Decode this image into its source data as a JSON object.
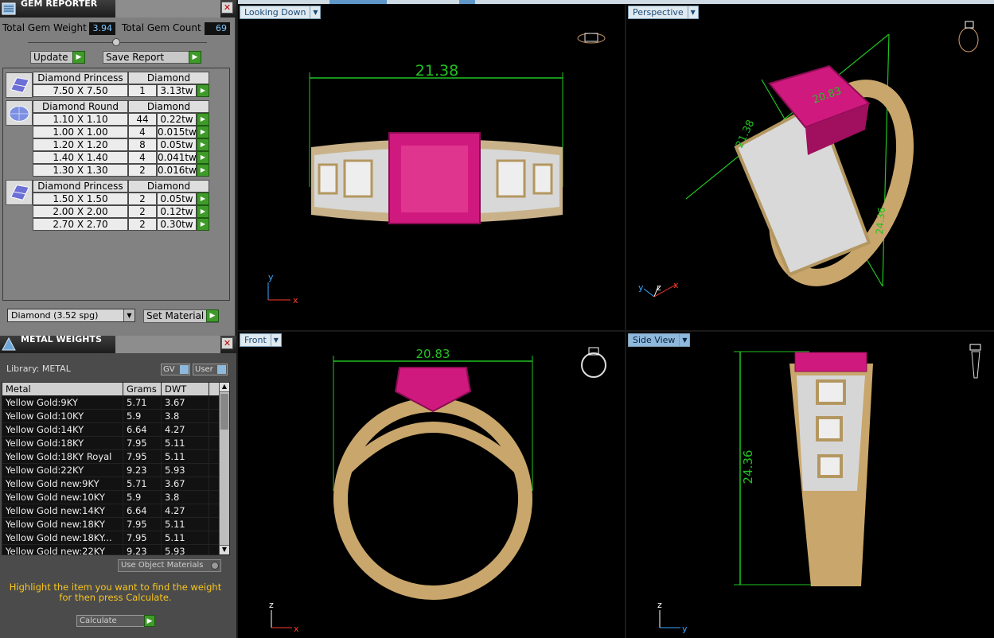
{
  "gem_reporter": {
    "title": "GEM REPORTER",
    "total_weight_label": "Total Gem Weight",
    "total_weight": "3.94",
    "total_count_label": "Total Gem Count",
    "total_count": "69",
    "update_label": "Update",
    "save_report_label": "Save Report",
    "groups": [
      {
        "name": "Diamond Princess",
        "material": "Diamond",
        "rows": [
          {
            "size": "7.50 X 7.50",
            "count": "1",
            "weight": "3.13tw"
          }
        ]
      },
      {
        "name": "Diamond Round",
        "material": "Diamond",
        "rows": [
          {
            "size": "1.10 X 1.10",
            "count": "44",
            "weight": "0.22tw"
          },
          {
            "size": "1.00 X 1.00",
            "count": "4",
            "weight": "0.015tw"
          },
          {
            "size": "1.20 X 1.20",
            "count": "8",
            "weight": "0.05tw"
          },
          {
            "size": "1.40 X 1.40",
            "count": "4",
            "weight": "0.041tw"
          },
          {
            "size": "1.30 X 1.30",
            "count": "2",
            "weight": "0.016tw"
          }
        ]
      },
      {
        "name": "Diamond Princess",
        "material": "Diamond",
        "rows": [
          {
            "size": "1.50 X 1.50",
            "count": "2",
            "weight": "0.05tw"
          },
          {
            "size": "2.00 X 2.00",
            "count": "2",
            "weight": "0.12tw"
          },
          {
            "size": "2.70 X 2.70",
            "count": "2",
            "weight": "0.30tw"
          }
        ]
      }
    ],
    "material_select": "Diamond     (3.52 spg)",
    "set_material_label": "Set Material"
  },
  "metal_weights": {
    "title": "METAL WEIGHTS",
    "library_label": "Library: METAL",
    "gv_label": "GV",
    "user_label": "User",
    "columns": [
      "Metal",
      "Grams",
      "DWT"
    ],
    "rows": [
      [
        "Yellow Gold:9KY",
        "5.71",
        "3.67"
      ],
      [
        "Yellow Gold:10KY",
        "5.9",
        "3.8"
      ],
      [
        "Yellow Gold:14KY",
        "6.64",
        "4.27"
      ],
      [
        "Yellow Gold:18KY",
        "7.95",
        "5.11"
      ],
      [
        "Yellow Gold:18KY Royal",
        "7.95",
        "5.11"
      ],
      [
        "Yellow Gold:22KY",
        "9.23",
        "5.93"
      ],
      [
        "Yellow Gold new:9KY",
        "5.71",
        "3.67"
      ],
      [
        "Yellow Gold new:10KY",
        "5.9",
        "3.8"
      ],
      [
        "Yellow Gold new:14KY",
        "6.64",
        "4.27"
      ],
      [
        "Yellow Gold new:18KY",
        "7.95",
        "5.11"
      ],
      [
        "Yellow Gold new:18KY...",
        "7.95",
        "5.11"
      ],
      [
        "Yellow Gold new:22KY",
        "9.23",
        "5.93"
      ]
    ],
    "use_object_materials_label": "Use Object Materials",
    "hint": "Highlight the item you want to find the weight for then press Calculate.",
    "calculate_label": "Calculate"
  },
  "viewports": [
    {
      "label": "Looking Down",
      "dimension": "21.38",
      "axes": [
        "y",
        "x"
      ]
    },
    {
      "label": "Perspective",
      "dimension": "20.83",
      "dimension2": "21.38",
      "dimension3": "24.36",
      "axes": [
        "y",
        "z",
        "x"
      ]
    },
    {
      "label": "Front",
      "dimension": "20.83",
      "axes": [
        "z",
        "x"
      ]
    },
    {
      "label": "Side View",
      "dimension": "24.36",
      "axes": [
        "z",
        "y"
      ]
    }
  ],
  "colors": {
    "dimension": "#21c321",
    "gem": "#d0197f",
    "gold": "#c9a66b",
    "accent": "#8fb9dc"
  }
}
